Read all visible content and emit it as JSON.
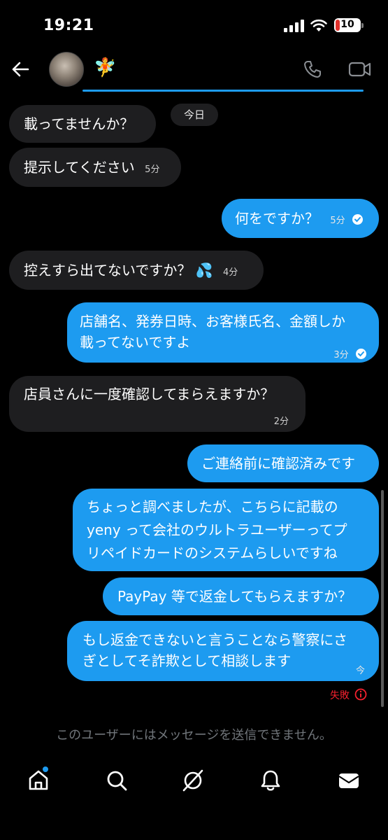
{
  "status_bar": {
    "time": "19:21",
    "battery": "10"
  },
  "header": {
    "contact_emoji": "🧚"
  },
  "date_separator": "今日",
  "messages": [
    {
      "dir": "in",
      "text": "載ってませんか？",
      "time": ""
    },
    {
      "dir": "in",
      "text": "提示してください",
      "time": "5分"
    },
    {
      "dir": "out",
      "text": "何をですか？",
      "time": "5分"
    },
    {
      "dir": "in",
      "text": "控えすら出てないですか？",
      "emoji": "💦",
      "time": "4分"
    },
    {
      "dir": "out",
      "lines": [
        "店舗名、発券日時、お客様氏名、金額しか",
        "載ってないですよ"
      ],
      "time": "3分"
    },
    {
      "dir": "in",
      "text": "店員さんに一度確認してまらえますか？",
      "time": "2分"
    },
    {
      "dir": "out",
      "text": "ご連絡前に確認済みです",
      "time": ""
    },
    {
      "dir": "out",
      "lines": [
        "ちょっと調べましたが、こちらに記載の",
        "yeny って会社のウルトラユーザーってプ",
        "リペイドカードのシステムらしいですね"
      ],
      "time": ""
    },
    {
      "dir": "out",
      "text": "PayPay 等で返金してもらえますか？",
      "time": ""
    },
    {
      "dir": "out",
      "lines": [
        "もし返金できないと言うことなら警察にさ",
        "ぎとしてそ詐欺として相談します"
      ],
      "time": "今"
    }
  ],
  "failed_label": "失敗",
  "composer_notice": "このユーザーにはメッセージを送信できません。",
  "nav": [
    "home-icon",
    "search-icon",
    "grok-icon",
    "bell-icon",
    "mail-icon"
  ],
  "colors": {
    "accent": "#1d9bf0",
    "incoming": "#1e1e20",
    "error": "#f4212e"
  }
}
